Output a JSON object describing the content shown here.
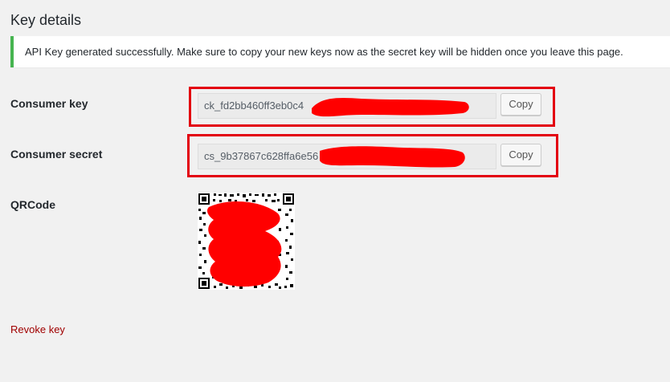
{
  "page": {
    "heading": "Key details"
  },
  "notice": {
    "message": "API Key generated successfully. Make sure to copy your new keys now as the secret key will be hidden once you leave this page.",
    "accent_color": "#46b450"
  },
  "consumer_key": {
    "label": "Consumer key",
    "value": "ck_fd2bb460ff3eb0c4",
    "copy_label": "Copy"
  },
  "consumer_secret": {
    "label": "Consumer secret",
    "value": "cs_9b37867c628ffa6e56",
    "copy_label": "Copy"
  },
  "qrcode": {
    "label": "QRCode"
  },
  "revoke": {
    "label": "Revoke key",
    "color": "#a00000"
  },
  "annotation": {
    "highlight_color": "#e3000f",
    "redaction_color": "#ff0000"
  }
}
